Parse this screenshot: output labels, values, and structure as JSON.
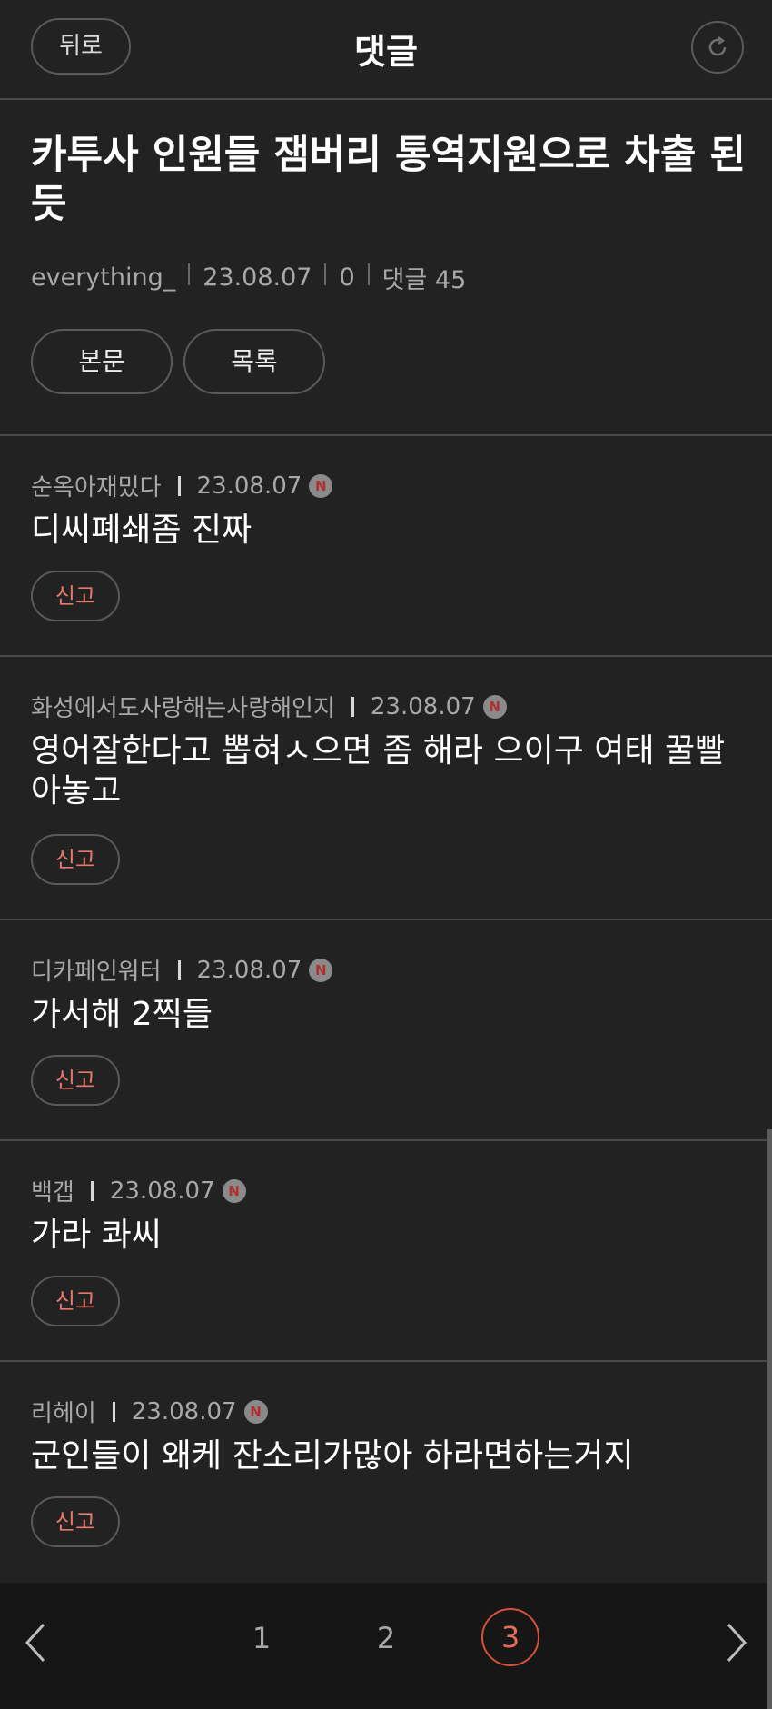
{
  "header": {
    "back_label": "뒤로",
    "title": "댓글",
    "refresh_icon": "refresh-icon"
  },
  "post": {
    "title": "카투사 인원들 잼버리 통역지원으로 차출 된듯",
    "author": "everything_",
    "date": "23.08.07",
    "count": "0",
    "comments_label": "댓글 45",
    "body_button": "본문",
    "list_button": "목록"
  },
  "comments": [
    {
      "author": "순옥아재밌다",
      "date": "23.08.07",
      "badge": "N",
      "text": "디씨폐쇄좀 진짜",
      "report": "신고"
    },
    {
      "author": "화성에서도사랑해는사랑해인지",
      "date": "23.08.07",
      "badge": "N",
      "text": "영어잘한다고 뽑혀ㅅ으면 좀 해라 으이구 여태 꿀빨아놓고",
      "report": "신고"
    },
    {
      "author": "디카페인워터",
      "date": "23.08.07",
      "badge": "N",
      "text": "가서해 2찍들",
      "report": "신고"
    },
    {
      "author": "백갭",
      "date": "23.08.07",
      "badge": "N",
      "text": "가라 콰씨",
      "report": "신고"
    },
    {
      "author": "리헤이",
      "date": "23.08.07",
      "badge": "N",
      "text": "군인들이 왜케 잔소리가많아 하라면하는거지",
      "report": "신고"
    }
  ],
  "pagination": {
    "pages": [
      "1",
      "2",
      "3"
    ],
    "current": "3",
    "prev_icon": "chevron-left-icon",
    "next_icon": "chevron-right-icon"
  },
  "colors": {
    "background": "#222223",
    "accent": "#e86a58",
    "divider": "#4a4a4c"
  }
}
